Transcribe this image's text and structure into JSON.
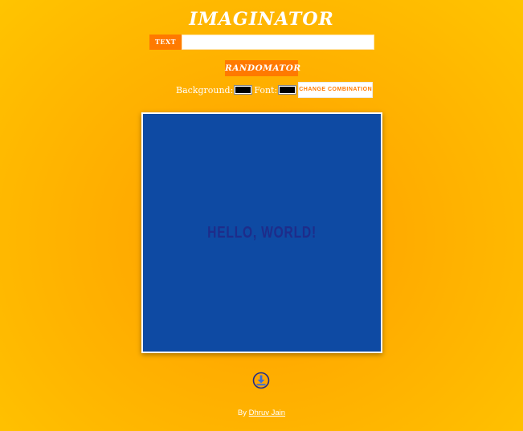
{
  "app": {
    "title": "IMAGINATOR"
  },
  "text_field": {
    "label": "TEXT",
    "value": ""
  },
  "randomator_button": {
    "label": "RANDOMATOR"
  },
  "combination": {
    "background_label": "Background:",
    "font_label": "Font:",
    "background_color": "#000000",
    "font_color": "#000000",
    "change_button_label": "CHANGE COMBINATION"
  },
  "canvas": {
    "text": "HELLO, WORLD!",
    "background_color": "#0e4aa3",
    "text_color": "#1e2c8a"
  },
  "download": {
    "icon": "download-icon"
  },
  "footer": {
    "by_text": "By",
    "author_name": "Dhruv Jain"
  }
}
